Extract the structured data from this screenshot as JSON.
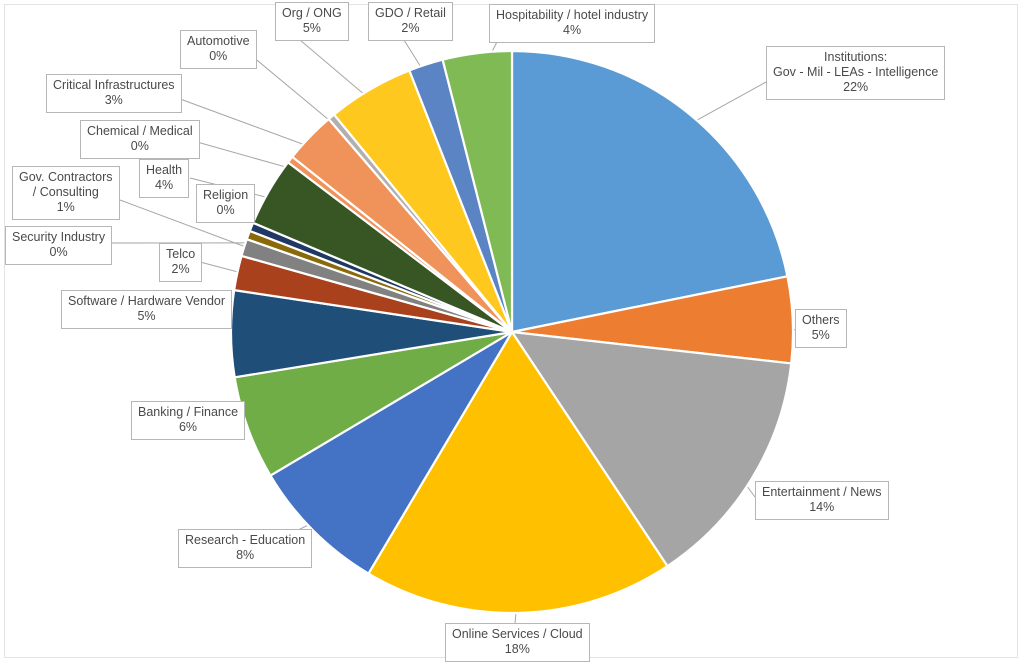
{
  "chart_data": {
    "type": "pie",
    "title": "",
    "subtitle": "",
    "xlabel": "",
    "ylabel": "",
    "legend_position": "none",
    "labels_style": "callout-boxes-with-leader-lines",
    "start_angle_deg": 0,
    "direction": "clockwise",
    "categories": [
      "Institutions: Gov - Mil - LEAs - Intelligence",
      "Others",
      "Entertainment / News",
      "Online Services / Cloud",
      "Research - Education",
      "Banking / Finance",
      "Software / Hardware Vendor",
      "Telco",
      "Gov. Contractors / Consulting",
      "Security Industry",
      "Religion",
      "Health",
      "Chemical / Medical",
      "Critical Infrastructures",
      "Automotive",
      "Org / ONG",
      "GDO / Retail",
      "Hospitability / hotel industry"
    ],
    "values": [
      22,
      5,
      14,
      18,
      8,
      6,
      5,
      2,
      1,
      0,
      0,
      4,
      0,
      3,
      0,
      5,
      2,
      4
    ],
    "value_labels": [
      "22%",
      "5%",
      "14%",
      "18%",
      "8%",
      "6%",
      "5%",
      "2%",
      "1%",
      "0%",
      "0%",
      "4%",
      "0%",
      "3%",
      "0%",
      "5%",
      "2%",
      "4%"
    ],
    "colors": [
      "#5B9BD5",
      "#ED7D31",
      "#A5A5A5",
      "#FFC000",
      "#4472C4",
      "#70AD47",
      "#1F4E79",
      "#A9421C",
      "#818181",
      "#8A6A08",
      "#1F3864",
      "#375623",
      "#F0935B",
      "#F0935B",
      "#B0B0B0",
      "#FFC81E",
      "#5B84C4",
      "#80BA55"
    ]
  },
  "slices": [
    {
      "name": "Institutions: Gov - Mil - LEAs - Intelligence",
      "label_line1": "Institutions:",
      "label_line2": "Gov - Mil - LEAs - Intelligence",
      "percent": "22%",
      "value": 22,
      "color": "#5B9BD5"
    },
    {
      "name": "Others",
      "label_line1": "Others",
      "label_line2": "",
      "percent": "5%",
      "value": 5,
      "color": "#ED7D31"
    },
    {
      "name": "Entertainment / News",
      "label_line1": "Entertainment / News",
      "label_line2": "",
      "percent": "14%",
      "value": 14,
      "color": "#A5A5A5"
    },
    {
      "name": "Online Services / Cloud",
      "label_line1": "Online Services / Cloud",
      "label_line2": "",
      "percent": "18%",
      "value": 18,
      "color": "#FFC000"
    },
    {
      "name": "Research - Education",
      "label_line1": "Research - Education",
      "label_line2": "",
      "percent": "8%",
      "value": 8,
      "color": "#4472C4"
    },
    {
      "name": "Banking / Finance",
      "label_line1": "Banking / Finance",
      "label_line2": "",
      "percent": "6%",
      "value": 6,
      "color": "#70AD47"
    },
    {
      "name": "Software / Hardware Vendor",
      "label_line1": "Software / Hardware Vendor",
      "label_line2": "",
      "percent": "5%",
      "value": 5,
      "color": "#1F4E79"
    },
    {
      "name": "Telco",
      "label_line1": "Telco",
      "label_line2": "",
      "percent": "2%",
      "value": 2,
      "color": "#A9421C"
    },
    {
      "name": "Gov. Contractors / Consulting",
      "label_line1": "Gov. Contractors",
      "label_line2": "/ Consulting",
      "percent": "1%",
      "value": 1,
      "color": "#818181"
    },
    {
      "name": "Security Industry",
      "label_line1": "Security Industry",
      "label_line2": "",
      "percent": "0%",
      "value": 0.5,
      "color": "#8A6A08"
    },
    {
      "name": "Religion",
      "label_line1": "Religion",
      "label_line2": "",
      "percent": "0%",
      "value": 0.5,
      "color": "#1F3864"
    },
    {
      "name": "Health",
      "label_line1": "Health",
      "label_line2": "",
      "percent": "4%",
      "value": 4,
      "color": "#375623"
    },
    {
      "name": "Chemical / Medical",
      "label_line1": "Chemical / Medical",
      "label_line2": "",
      "percent": "0%",
      "value": 0.4,
      "color": "#F0935B"
    },
    {
      "name": "Critical Infrastructures",
      "label_line1": "Critical Infrastructures",
      "label_line2": "",
      "percent": "3%",
      "value": 3,
      "color": "#F0935B"
    },
    {
      "name": "Automotive",
      "label_line1": "Automotive",
      "label_line2": "",
      "percent": "0%",
      "value": 0.4,
      "color": "#B0B0B0"
    },
    {
      "name": "Org / ONG",
      "label_line1": "Org / ONG",
      "label_line2": "",
      "percent": "5%",
      "value": 5,
      "color": "#FFC81E"
    },
    {
      "name": "GDO / Retail",
      "label_line1": "GDO / Retail",
      "label_line2": "",
      "percent": "2%",
      "value": 2,
      "color": "#5B84C4"
    },
    {
      "name": "Hospitability / hotel industry",
      "label_line1": "Hospitability / hotel industry",
      "label_line2": "",
      "percent": "4%",
      "value": 4,
      "color": "#80BA55"
    }
  ]
}
